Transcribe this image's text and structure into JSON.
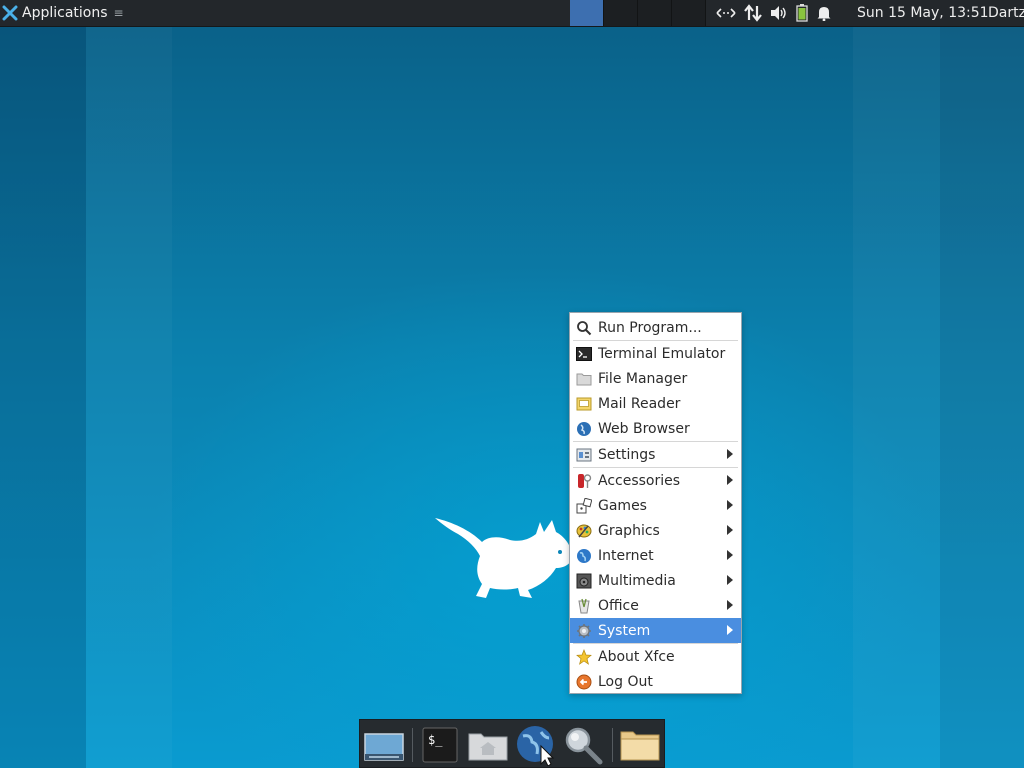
{
  "top_panel": {
    "applications_label": "Applications",
    "clock": "Sun 15 May, 13:51",
    "user": "Dartz"
  },
  "menu": {
    "items": [
      {
        "label": "Run Program...",
        "icon": "search-icon"
      },
      {
        "label": "Terminal Emulator",
        "icon": "terminal-icon"
      },
      {
        "label": "File Manager",
        "icon": "folder-icon"
      },
      {
        "label": "Mail Reader",
        "icon": "mail-icon"
      },
      {
        "label": "Web Browser",
        "icon": "globe-icon"
      },
      {
        "label": "Settings",
        "icon": "settings-icon",
        "submenu": true
      },
      {
        "label": "Accessories",
        "icon": "accessories-icon",
        "submenu": true
      },
      {
        "label": "Games",
        "icon": "games-icon",
        "submenu": true
      },
      {
        "label": "Graphics",
        "icon": "graphics-icon",
        "submenu": true
      },
      {
        "label": "Internet",
        "icon": "internet-icon",
        "submenu": true
      },
      {
        "label": "Multimedia",
        "icon": "multimedia-icon",
        "submenu": true
      },
      {
        "label": "Office",
        "icon": "office-icon",
        "submenu": true
      },
      {
        "label": "System",
        "icon": "system-icon",
        "submenu": true,
        "selected": true
      },
      {
        "label": "About Xfce",
        "icon": "star-icon"
      },
      {
        "label": "Log Out",
        "icon": "logout-icon"
      }
    ]
  },
  "dock": {
    "items": [
      {
        "icon": "show-desktop-icon"
      },
      {
        "icon": "terminal-icon"
      },
      {
        "icon": "home-folder-icon"
      },
      {
        "icon": "web-browser-icon"
      },
      {
        "icon": "app-finder-icon"
      },
      {
        "icon": "files-folder-icon"
      }
    ]
  },
  "colors": {
    "panel_bg": "#23272b",
    "selection": "#4a8ee0",
    "desktop": "#0b7aa8"
  }
}
